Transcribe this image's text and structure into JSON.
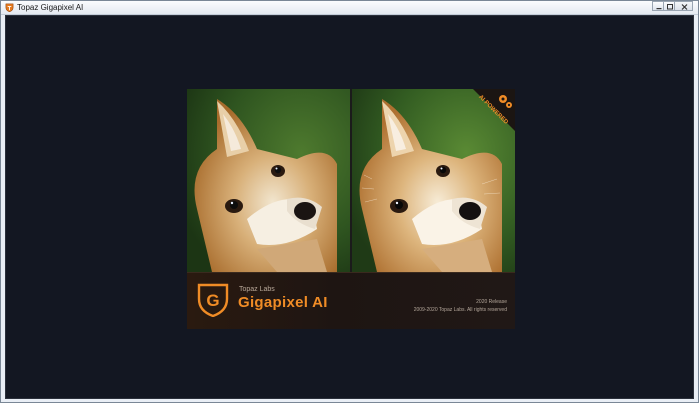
{
  "window": {
    "title": "Topaz Gigapixel AI"
  },
  "splash": {
    "company": "Topaz Labs",
    "product": "Gigapixel AI",
    "logo_letter": "G",
    "badge": "AI POWERED",
    "badge_icon": "gears-icon",
    "release": "2020 Release",
    "copyright": "2009-2020 Topaz Labs. All rights reserved"
  },
  "colors": {
    "accent": "#f08c26",
    "background": "#131722"
  }
}
